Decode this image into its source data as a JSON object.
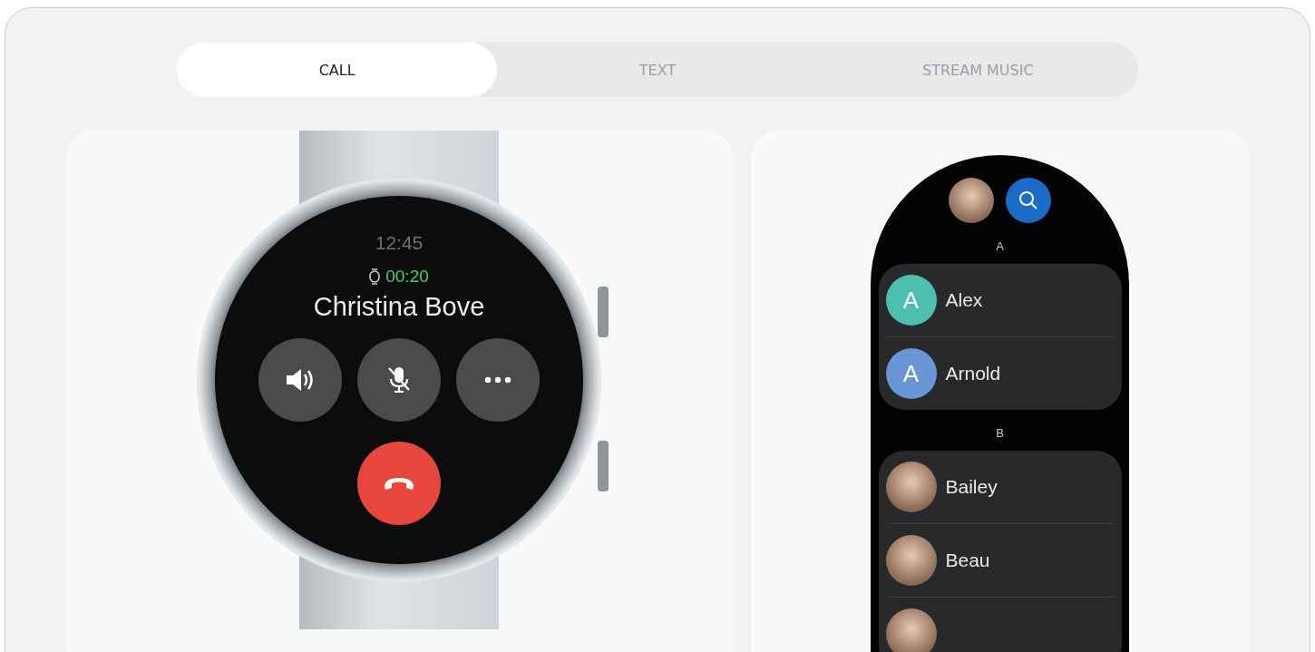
{
  "tabs": [
    {
      "label": "CALL",
      "selected": true
    },
    {
      "label": "TEXT",
      "selected": false
    },
    {
      "label": "STREAM MUSIC",
      "selected": false
    }
  ],
  "call_screen": {
    "clock": "12:45",
    "duration": "00:20",
    "caller": "Christina Bove",
    "actions": [
      {
        "kind": "speaker"
      },
      {
        "kind": "mute"
      },
      {
        "kind": "more"
      }
    ]
  },
  "contacts": {
    "sections": [
      {
        "letter": "A",
        "contacts": [
          {
            "name": "Alex",
            "kind": "initial",
            "initial": "A",
            "color": "#4cbfb1"
          },
          {
            "name": "Arnold",
            "kind": "initial",
            "initial": "A",
            "color": "#6a96d8"
          }
        ]
      },
      {
        "letter": "B",
        "contacts": [
          {
            "name": "Bailey",
            "kind": "photo"
          },
          {
            "name": "Beau",
            "kind": "photo"
          },
          {
            "kind": "photo"
          }
        ]
      }
    ]
  }
}
